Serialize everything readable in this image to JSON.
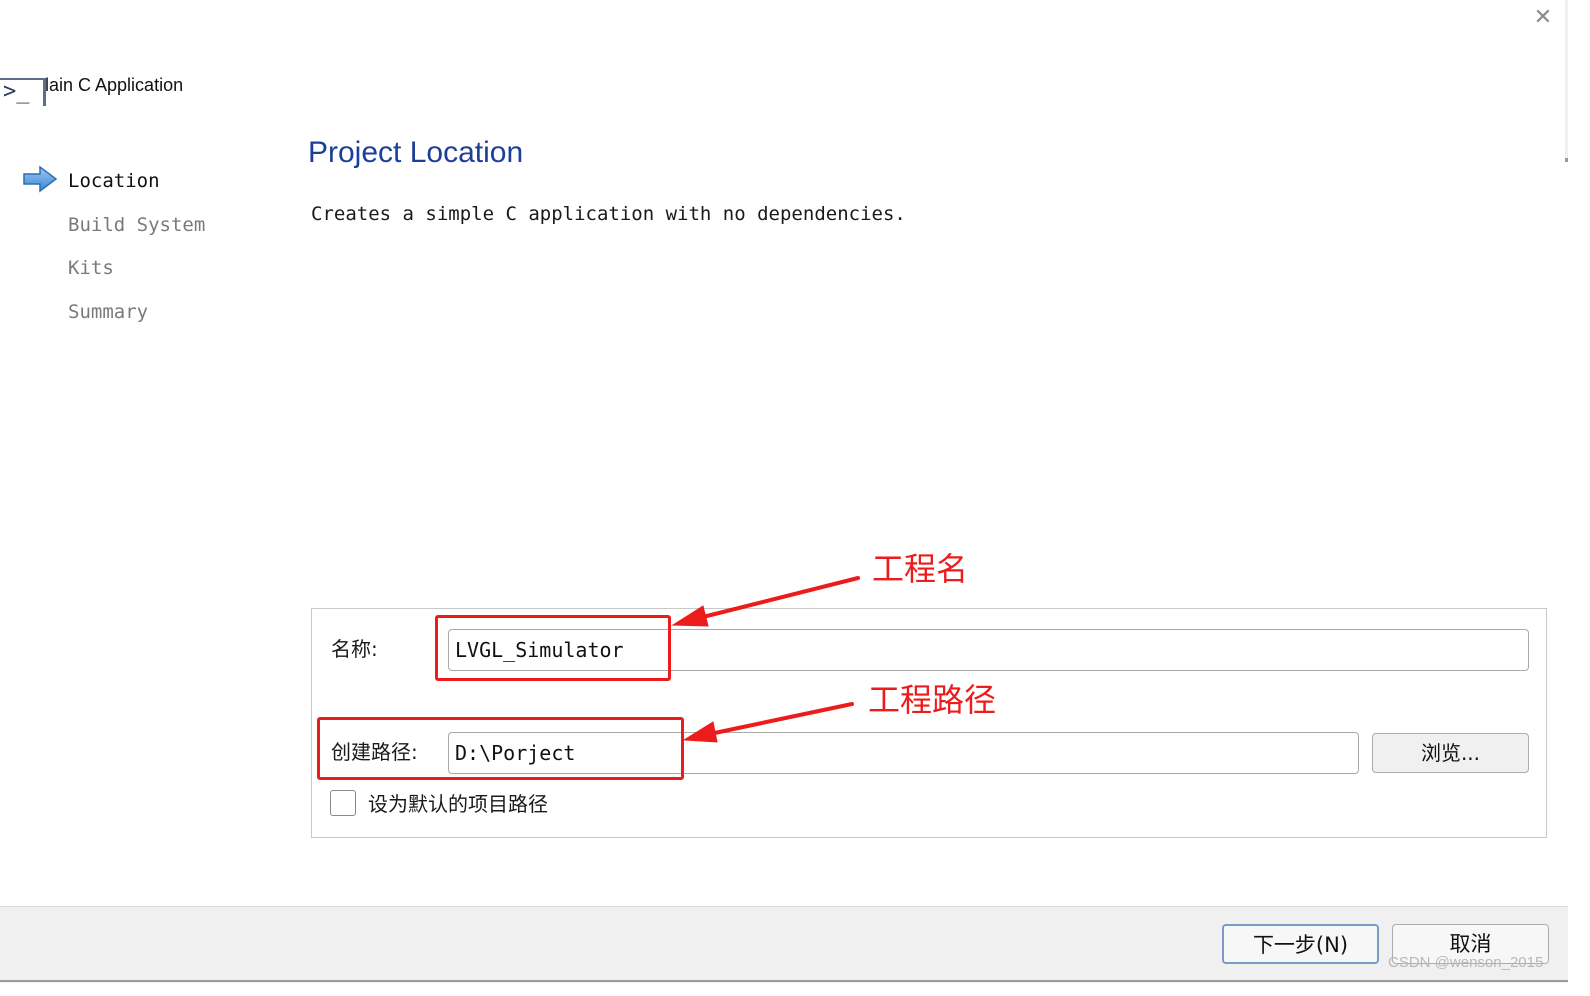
{
  "window": {
    "title": "Plain C Application",
    "close_icon": "close-icon"
  },
  "steps": [
    {
      "label": "Location",
      "state": "current"
    },
    {
      "label": "Build System",
      "state": "pending"
    },
    {
      "label": "Kits",
      "state": "pending"
    },
    {
      "label": "Summary",
      "state": "pending"
    }
  ],
  "page": {
    "title": "Project Location",
    "description": "Creates a simple C application with no dependencies."
  },
  "form": {
    "name_label": "名称:",
    "name_value": "LVGL_Simulator",
    "path_label": "创建路径:",
    "path_value": "D:\\Porject",
    "browse_label": "浏览...",
    "default_path_checkbox_label": "设为默认的项目路径",
    "default_path_checked": false
  },
  "annotations": {
    "project_name": "工程名",
    "project_path": "工程路径",
    "color": "#ec1c1c"
  },
  "footer": {
    "next_label": "下一步(N)",
    "cancel_label": "取消"
  },
  "watermark": "CSDN @wenson_2015",
  "colors": {
    "title_blue": "#1d3f9a",
    "annotation_red": "#ec1c1c",
    "footer_bg": "#f0f0f0"
  }
}
